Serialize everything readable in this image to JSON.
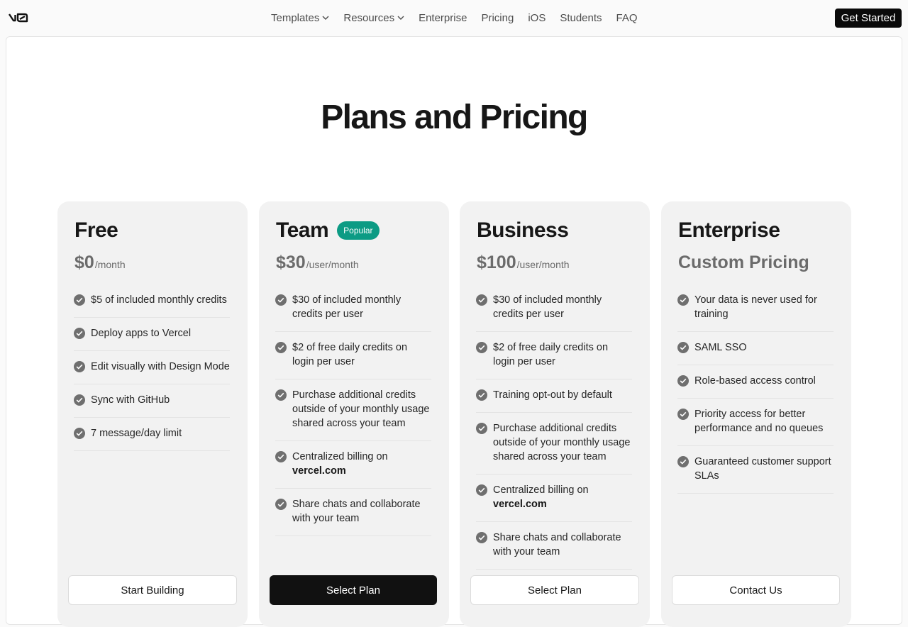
{
  "nav": {
    "logo_icon": "v0-logo-icon",
    "links": [
      {
        "label": "Templates",
        "dropdown": true
      },
      {
        "label": "Resources",
        "dropdown": true
      },
      {
        "label": "Enterprise",
        "dropdown": false
      },
      {
        "label": "Pricing",
        "dropdown": false
      },
      {
        "label": "iOS",
        "dropdown": false
      },
      {
        "label": "Students",
        "dropdown": false
      },
      {
        "label": "FAQ",
        "dropdown": false
      }
    ],
    "cta_label": "Get Started"
  },
  "page": {
    "title": "Plans and Pricing"
  },
  "colors": {
    "badge": "#0c9b84",
    "primary_button": "#111111",
    "check": "#6f6f6f"
  },
  "plans": [
    {
      "name": "Free",
      "price": "$0",
      "period": "/month",
      "features": [
        {
          "text": "$5 of included monthly credits"
        },
        {
          "text": "Deploy apps to Vercel"
        },
        {
          "text": "Edit visually with Design Mode"
        },
        {
          "text": "Sync with GitHub"
        },
        {
          "text": "7 message/day limit"
        }
      ],
      "cta": "Start Building"
    },
    {
      "name": "Team",
      "badge": "Popular",
      "price": "$30",
      "period": "/user/month",
      "features": [
        {
          "text": "$30 of included monthly credits per user"
        },
        {
          "text": "$2 of free daily credits on login per user"
        },
        {
          "text": "Purchase additional credits outside of your monthly usage shared across your team"
        },
        {
          "text": "Centralized billing on",
          "bold": "vercel.com"
        },
        {
          "text": "Share chats and collaborate with your team"
        }
      ],
      "cta": "Select Plan"
    },
    {
      "name": "Business",
      "price": "$100",
      "period": "/user/month",
      "features": [
        {
          "text": "$30 of included monthly credits per user"
        },
        {
          "text": "$2 of free daily credits on login per user"
        },
        {
          "text": "Training opt-out by default"
        },
        {
          "text": "Purchase additional credits outside of your monthly usage shared across your team"
        },
        {
          "text": "Centralized billing on",
          "bold": "vercel.com"
        },
        {
          "text": "Share chats and collaborate with your team"
        }
      ],
      "cta": "Select Plan"
    },
    {
      "name": "Enterprise",
      "price": "Custom Pricing",
      "features": [
        {
          "text": "Your data is never used for training"
        },
        {
          "text": "SAML SSO"
        },
        {
          "text": "Role-based access control"
        },
        {
          "text": "Priority access for better performance and no queues"
        },
        {
          "text": "Guaranteed customer support SLAs"
        }
      ],
      "cta": "Contact Us"
    }
  ]
}
